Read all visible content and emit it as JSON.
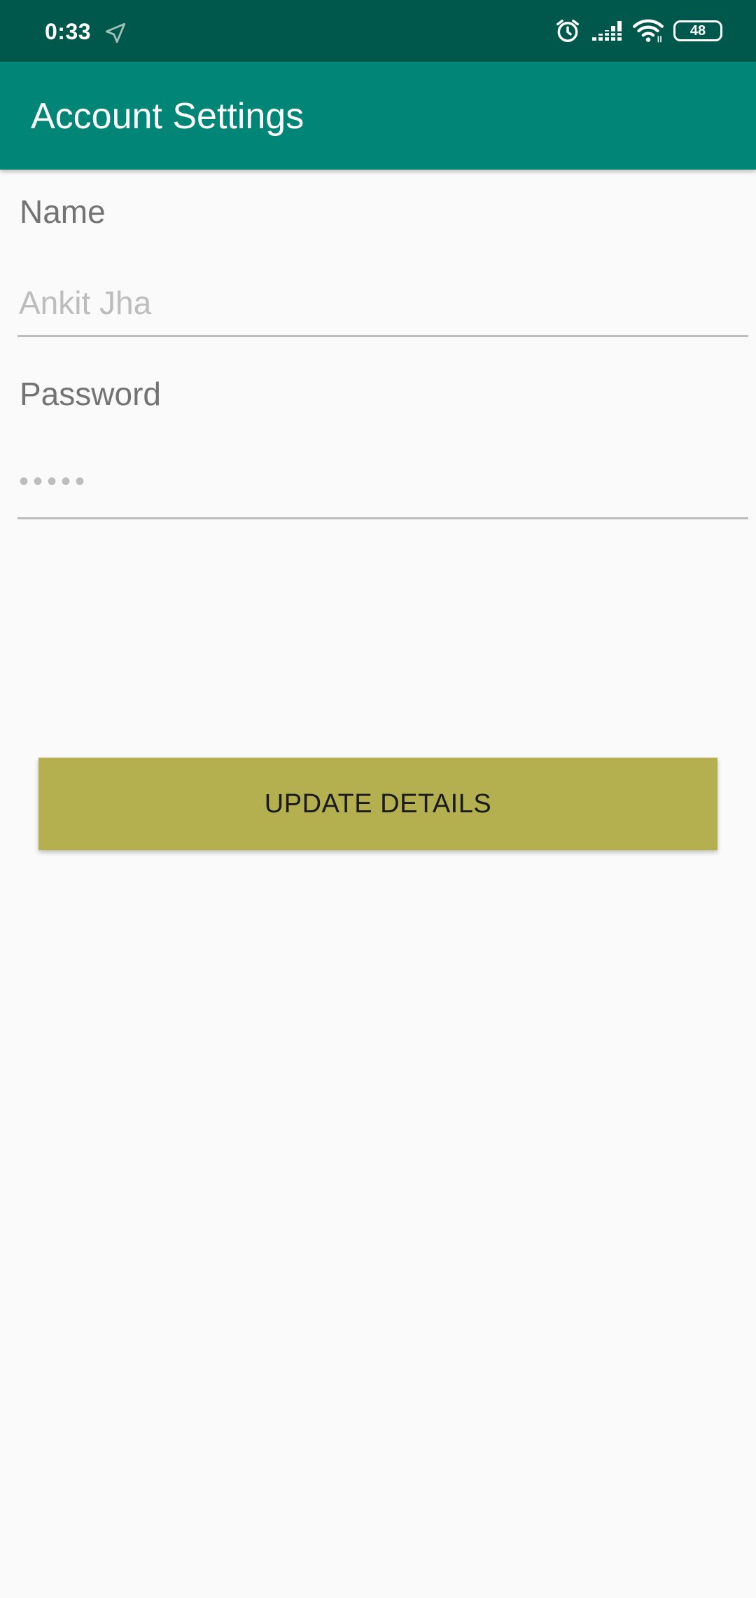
{
  "status_bar": {
    "time": "0:33",
    "battery_level": "48",
    "icons": [
      "location-arrow-icon",
      "alarm-icon",
      "signal-icon",
      "wifi-icon",
      "battery-icon"
    ]
  },
  "app_bar": {
    "title": "Account Settings"
  },
  "form": {
    "name_label": "Name",
    "name_placeholder": "Ankit Jha",
    "password_label": "Password",
    "password_placeholder": "•••••",
    "update_button_label": "UPDATE DETAILS"
  },
  "colors": {
    "status_bar": "#00574b",
    "app_bar": "#008577",
    "button": "#b4b04f",
    "background": "#fafafa"
  }
}
